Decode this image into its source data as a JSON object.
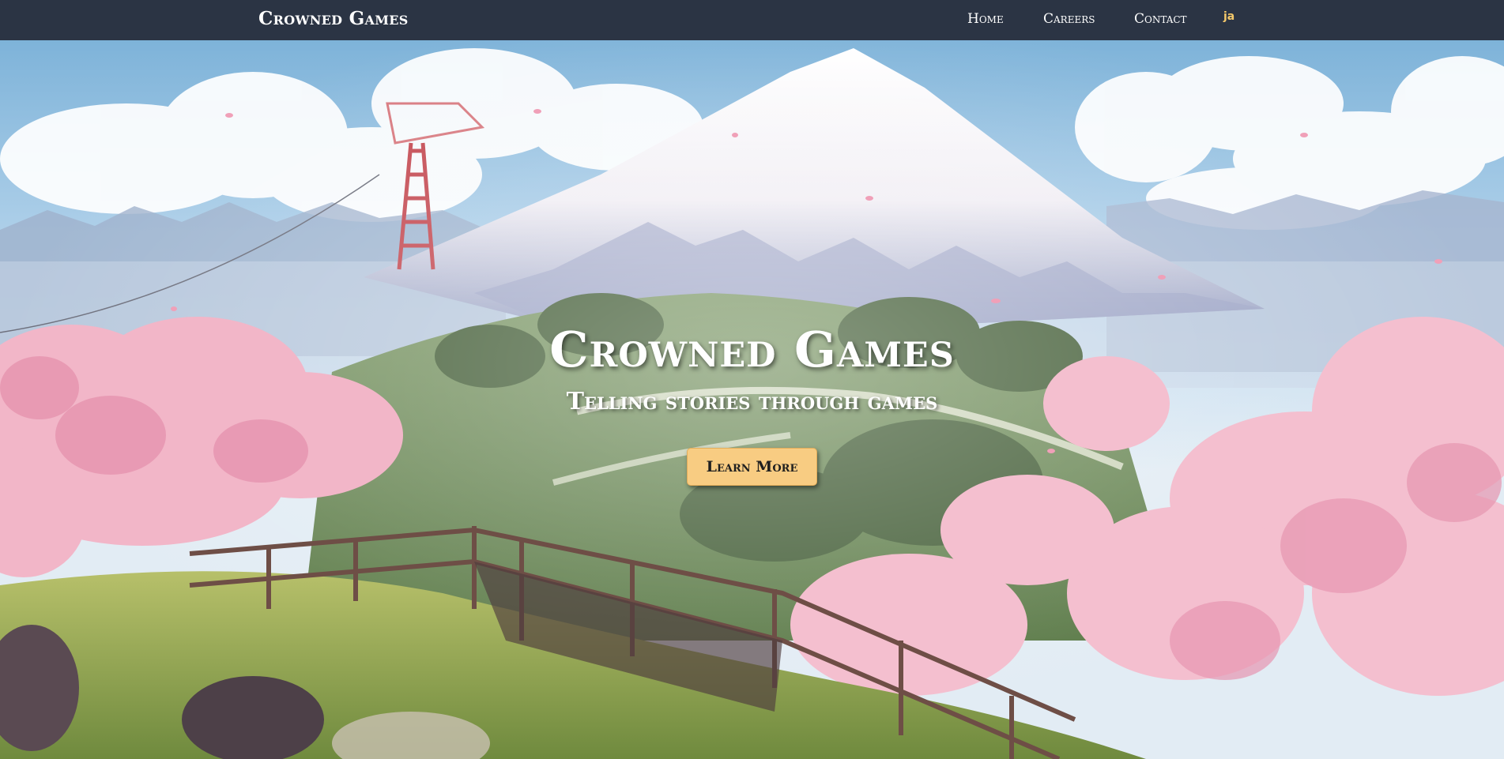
{
  "nav": {
    "brand": "Crowned Games",
    "links": [
      {
        "label": "Home"
      },
      {
        "label": "Careers"
      },
      {
        "label": "Contact"
      }
    ],
    "language": "ja"
  },
  "hero": {
    "title": "Crowned Games",
    "subtitle": "Telling stories through games",
    "cta_label": "Learn More"
  },
  "colors": {
    "navbar_bg": "#2b3444",
    "accent": "#f8cc82",
    "language_link": "#f5c96b"
  }
}
